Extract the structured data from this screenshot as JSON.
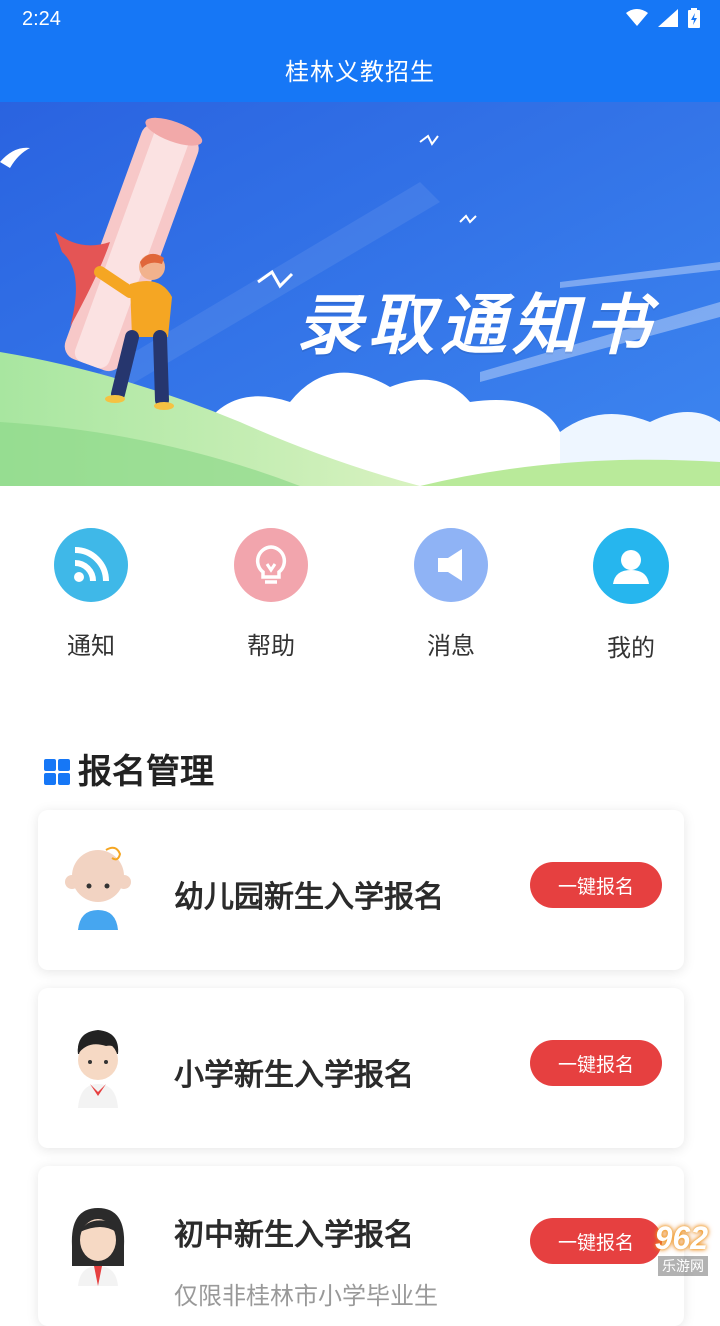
{
  "status_bar": {
    "time": "2:24",
    "icons": [
      "wifi-icon",
      "signal-icon",
      "battery-charging-icon"
    ]
  },
  "app_bar": {
    "title": "桂林义教招生"
  },
  "banner": {
    "title": "录取通知书"
  },
  "quick_menu": [
    {
      "label": "通知",
      "icon": "rss-icon",
      "color": "#3fb8e8"
    },
    {
      "label": "帮助",
      "icon": "lightbulb-icon",
      "color": "#f2a5ad"
    },
    {
      "label": "消息",
      "icon": "speaker-icon",
      "color": "#8fb3f5"
    },
    {
      "label": "我的",
      "icon": "user-icon",
      "color": "#26b6ee"
    }
  ],
  "section": {
    "title": "报名管理"
  },
  "cards": [
    {
      "title": "幼儿园新生入学报名",
      "subtitle": "",
      "button": "一键报名",
      "avatar": "baby-avatar-icon"
    },
    {
      "title": "小学新生入学报名",
      "subtitle": "",
      "button": "一键报名",
      "avatar": "boy-avatar-icon"
    },
    {
      "title": "初中新生入学报名",
      "subtitle": "仅限非桂林市小学毕业生",
      "button": "一键报名",
      "avatar": "girl-avatar-icon"
    }
  ],
  "watermark": {
    "main": "962",
    "sub": "乐游网"
  },
  "colors": {
    "primary": "#1677f6",
    "button": "#e64040"
  }
}
